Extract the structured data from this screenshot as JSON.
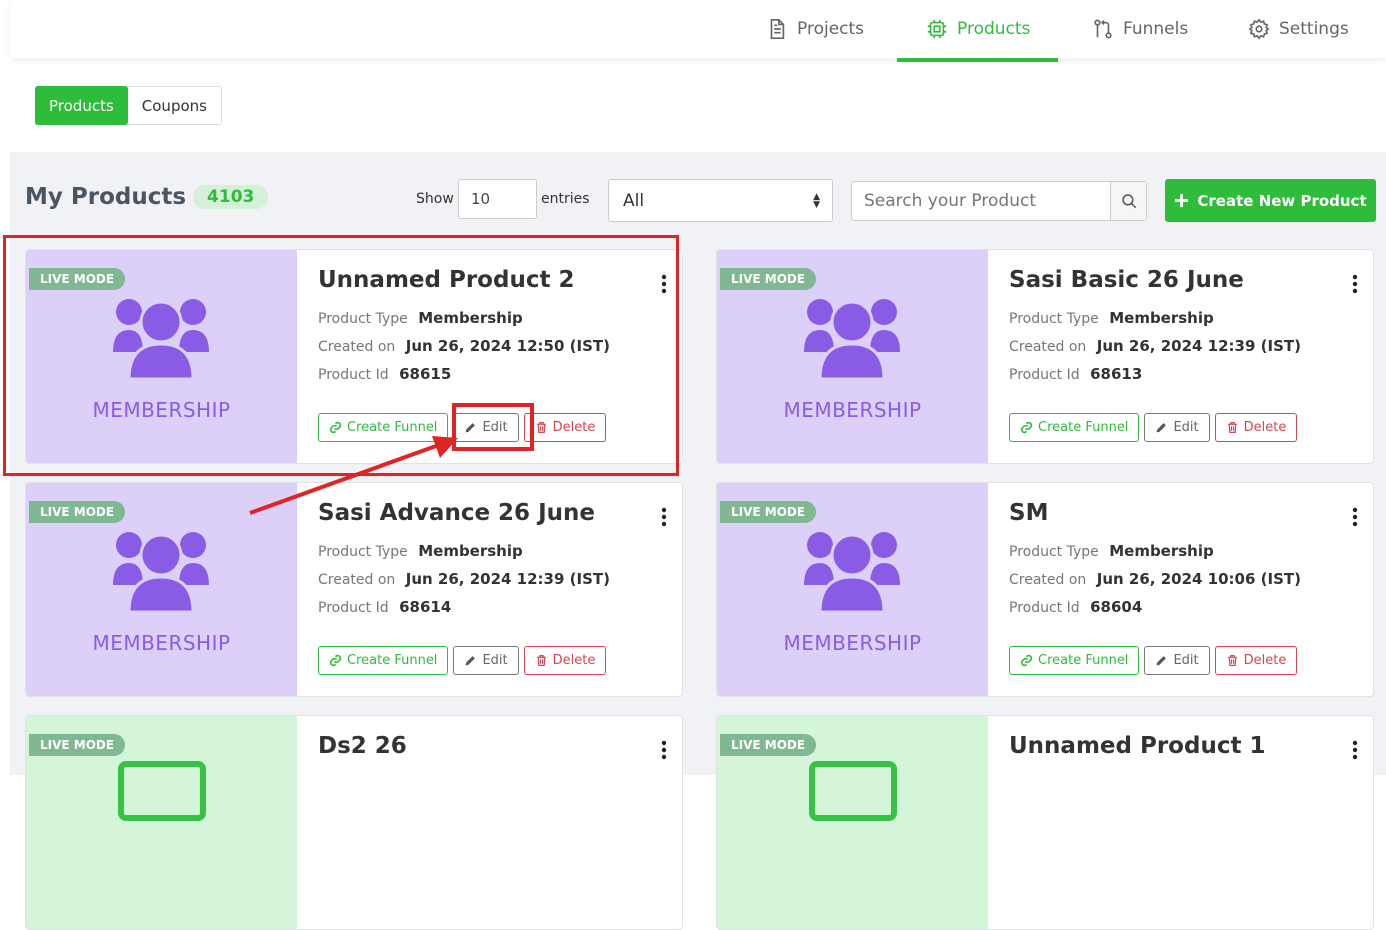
{
  "nav": {
    "projects": "Projects",
    "products": "Products",
    "funnels": "Funnels",
    "settings": "Settings"
  },
  "subtabs": {
    "products": "Products",
    "coupons": "Coupons"
  },
  "heading": {
    "title": "My Products",
    "count": "4103"
  },
  "controls": {
    "show_label": "Show",
    "entries_value": "10",
    "entries_label": "entries",
    "filter_value": "All",
    "search_placeholder": "Search your Product",
    "create_label": "Create New Product"
  },
  "labels": {
    "product_type": "Product Type",
    "created_on": "Created on",
    "product_id": "Product Id",
    "live_mode": "LIVE MODE",
    "create_funnel": "Create Funnel",
    "edit": "Edit",
    "delete": "Delete"
  },
  "products": [
    {
      "name": "Unnamed Product 2",
      "type": "Membership",
      "created": "Jun 26, 2024 12:50 (IST)",
      "id": "68615",
      "thumb": "MEMBERSHIP"
    },
    {
      "name": "Sasi Basic 26 June",
      "type": "Membership",
      "created": "Jun 26, 2024 12:39 (IST)",
      "id": "68613",
      "thumb": "MEMBERSHIP"
    },
    {
      "name": "Sasi Advance 26 June",
      "type": "Membership",
      "created": "Jun 26, 2024 12:39 (IST)",
      "id": "68614",
      "thumb": "MEMBERSHIP"
    },
    {
      "name": "SM",
      "type": "Membership",
      "created": "Jun 26, 2024 10:06 (IST)",
      "id": "68604",
      "thumb": "MEMBERSHIP"
    },
    {
      "name": "Ds2 26"
    },
    {
      "name": "Unnamed Product 1"
    }
  ],
  "colors": {
    "accent": "#2dbd3b",
    "danger": "#d9444f",
    "highlight": "#e02424",
    "membership": "#8a5ce6"
  }
}
